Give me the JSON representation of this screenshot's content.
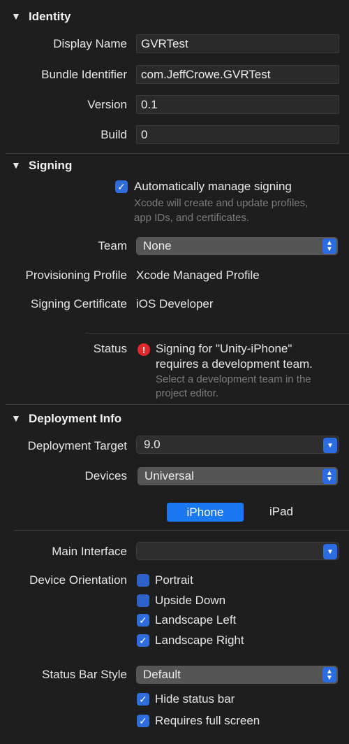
{
  "identity": {
    "title": "Identity",
    "display_name_label": "Display Name",
    "display_name_value": "GVRTest",
    "bundle_id_label": "Bundle Identifier",
    "bundle_id_value": "com.JeffCrowe.GVRTest",
    "version_label": "Version",
    "version_value": "0.1",
    "build_label": "Build",
    "build_value": "0"
  },
  "signing": {
    "title": "Signing",
    "auto_manage_label": "Automatically manage signing",
    "auto_manage_checked": true,
    "auto_manage_hint_1": "Xcode will create and update profiles,",
    "auto_manage_hint_2": "app IDs, and certificates.",
    "team_label": "Team",
    "team_value": "None",
    "prov_profile_label": "Provisioning Profile",
    "prov_profile_value": "Xcode Managed Profile",
    "signing_cert_label": "Signing Certificate",
    "signing_cert_value": "iOS Developer",
    "status_label": "Status",
    "status_line_1": "Signing for \"Unity-iPhone\"",
    "status_line_2": "requires a development team.",
    "status_hint_1": "Select a development team in the",
    "status_hint_2": "project editor."
  },
  "deployment": {
    "title": "Deployment Info",
    "target_label": "Deployment Target",
    "target_value": "9.0",
    "devices_label": "Devices",
    "devices_value": "Universal",
    "seg_iphone": "iPhone",
    "seg_ipad": "iPad",
    "main_interface_label": "Main Interface",
    "main_interface_value": "",
    "orientation_label": "Device Orientation",
    "orientations": [
      {
        "label": "Portrait",
        "checked": false
      },
      {
        "label": "Upside Down",
        "checked": false
      },
      {
        "label": "Landscape Left",
        "checked": true
      },
      {
        "label": "Landscape Right",
        "checked": true
      }
    ],
    "status_bar_label": "Status Bar Style",
    "status_bar_value": "Default",
    "hide_status_bar_label": "Hide status bar",
    "requires_full_screen_label": "Requires full screen"
  },
  "colors": {
    "background": "#1e1e1e",
    "accent": "#2b6de0",
    "error": "#e0282d"
  }
}
